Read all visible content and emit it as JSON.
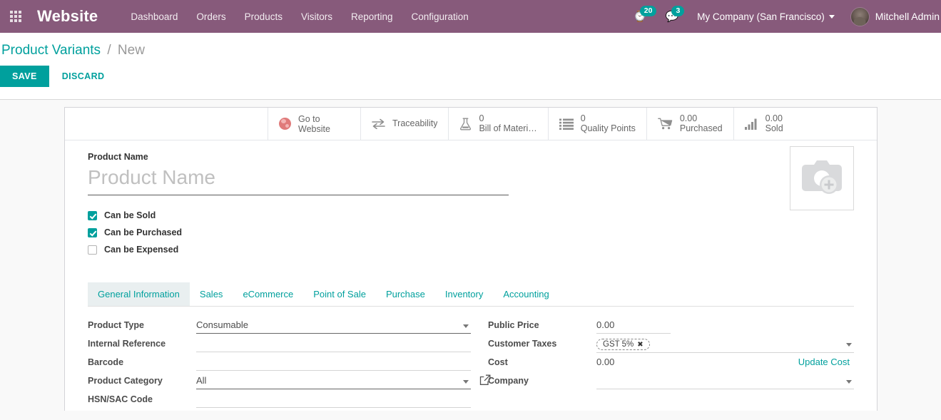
{
  "navbar": {
    "apps_icon": "apps-grid-icon",
    "brand": "Website",
    "menu": [
      {
        "label": "Dashboard"
      },
      {
        "label": "Orders"
      },
      {
        "label": "Products"
      },
      {
        "label": "Visitors"
      },
      {
        "label": "Reporting"
      },
      {
        "label": "Configuration"
      }
    ],
    "activity": {
      "icon": "clock-activity-icon",
      "count": "20"
    },
    "messages": {
      "icon": "chat-bubble-icon",
      "count": "3"
    },
    "company": "My Company (San Francisco)",
    "user": "Mitchell Admin"
  },
  "control_panel": {
    "breadcrumb_root": "Product Variants",
    "breadcrumb_sep": "/",
    "breadcrumb_current": "New",
    "save_label": "SAVE",
    "discard_label": "DISCARD"
  },
  "stat_buttons": [
    {
      "icon": "globe-icon",
      "value": "",
      "label": "Go to Website",
      "two_line": true
    },
    {
      "icon": "exchange-icon",
      "value": "",
      "label": "Traceability",
      "two_line": false
    },
    {
      "icon": "flask-icon",
      "value": "0",
      "label": "Bill of Materi…",
      "two_line": true
    },
    {
      "icon": "list-icon",
      "value": "0",
      "label": "Quality Points",
      "two_line": true
    },
    {
      "icon": "cart-icon",
      "value": "0.00",
      "label": "Purchased",
      "two_line": true
    },
    {
      "icon": "bar-chart-icon",
      "value": "0.00",
      "label": "Sold",
      "two_line": true
    }
  ],
  "form": {
    "name_label": "Product Name",
    "name_value": "",
    "name_placeholder": "Product Name",
    "image_placeholder_icon": "camera-add-icon",
    "checkboxes": [
      {
        "label": "Can be Sold",
        "checked": true
      },
      {
        "label": "Can be Purchased",
        "checked": true
      },
      {
        "label": "Can be Expensed",
        "checked": false
      }
    ],
    "tabs": [
      {
        "label": "General Information",
        "active": true
      },
      {
        "label": "Sales",
        "active": false
      },
      {
        "label": "eCommerce",
        "active": false
      },
      {
        "label": "Point of Sale",
        "active": false
      },
      {
        "label": "Purchase",
        "active": false
      },
      {
        "label": "Inventory",
        "active": false
      },
      {
        "label": "Accounting",
        "active": false
      }
    ],
    "left_fields": {
      "product_type_label": "Product Type",
      "product_type_value": "Consumable",
      "internal_reference_label": "Internal Reference",
      "internal_reference_value": "",
      "barcode_label": "Barcode",
      "barcode_value": "",
      "product_category_label": "Product Category",
      "product_category_value": "All",
      "hsn_label": "HSN/SAC Code"
    },
    "right_fields": {
      "public_price_label": "Public Price",
      "public_price_value": "0.00",
      "customer_taxes_label": "Customer Taxes",
      "customer_taxes_tag": "GST 5%",
      "cost_label": "Cost",
      "cost_value": "0.00",
      "update_cost_label": "Update Cost",
      "company_label": "Company",
      "company_value": ""
    }
  },
  "colors": {
    "brand_purple": "#875A7B",
    "accent_teal": "#00A09D",
    "page_bg": "#f9f9f9",
    "globe_red": "#e07a7a"
  }
}
